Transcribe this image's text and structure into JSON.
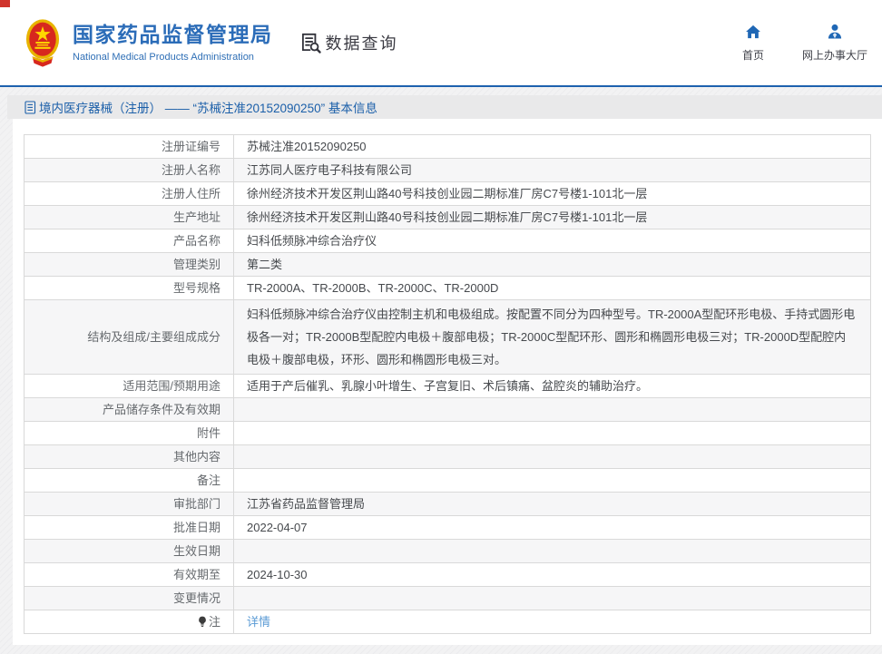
{
  "header": {
    "org_name_cn": "国家药品监督管理局",
    "org_name_en": "National Medical Products Administration",
    "portal_title": "数据查询",
    "nav_home": "首页",
    "nav_hall": "网上办事大厅"
  },
  "breadcrumb": {
    "text": "境内医疗器械（注册） —— “苏械注准20152090250” 基本信息"
  },
  "table": {
    "rows": [
      {
        "label": "注册证编号",
        "value": "苏械注准20152090250"
      },
      {
        "label": "注册人名称",
        "value": "江苏同人医疗电子科技有限公司"
      },
      {
        "label": "注册人住所",
        "value": "徐州经济技术开发区荆山路40号科技创业园二期标准厂房C7号楼1-101北一层"
      },
      {
        "label": "生产地址",
        "value": "徐州经济技术开发区荆山路40号科技创业园二期标准厂房C7号楼1-101北一层"
      },
      {
        "label": "产品名称",
        "value": "妇科低频脉冲综合治疗仪"
      },
      {
        "label": "管理类别",
        "value": "第二类"
      },
      {
        "label": "型号规格",
        "value": "TR-2000A、TR-2000B、TR-2000C、TR-2000D"
      },
      {
        "label": "结构及组成/主要组成成分",
        "value": "妇科低频脉冲综合治疗仪由控制主机和电极组成。按配置不同分为四种型号。TR-2000A型配环形电极、手持式圆形电极各一对；TR-2000B型配腔内电极＋腹部电极；TR-2000C型配环形、圆形和椭圆形电极三对；TR-2000D型配腔内电极＋腹部电极，环形、圆形和椭圆形电极三对。"
      },
      {
        "label": "适用范围/预期用途",
        "value": "适用于产后催乳、乳腺小叶增生、子宫复旧、术后镇痛、盆腔炎的辅助治疗。"
      },
      {
        "label": "产品储存条件及有效期",
        "value": ""
      },
      {
        "label": "附件",
        "value": ""
      },
      {
        "label": "其他内容",
        "value": ""
      },
      {
        "label": "备注",
        "value": ""
      },
      {
        "label": "审批部门",
        "value": "江苏省药品监督管理局"
      },
      {
        "label": "批准日期",
        "value": "2022-04-07"
      },
      {
        "label": "生效日期",
        "value": ""
      },
      {
        "label": "有效期至",
        "value": "2024-10-30"
      },
      {
        "label": "变更情况",
        "value": ""
      },
      {
        "label": "注",
        "value": "详情"
      }
    ]
  },
  "icons": {
    "emblem": "national-emblem",
    "portal": "document-search-icon",
    "home": "home-icon",
    "hall": "user-icon",
    "breadcrumb": "document-icon",
    "note": "bulb-icon"
  },
  "colors": {
    "brand_blue": "#2b6cb8",
    "header_line_blue": "#1d61ae",
    "breadcrumb_blue": "#1b5fa9",
    "link_blue": "#5b9bd5",
    "alt_row_bg": "#f6f6f7",
    "emblem_red": "#d7281e",
    "emblem_gold": "#e8b400",
    "corner_red": "#d0342c"
  }
}
